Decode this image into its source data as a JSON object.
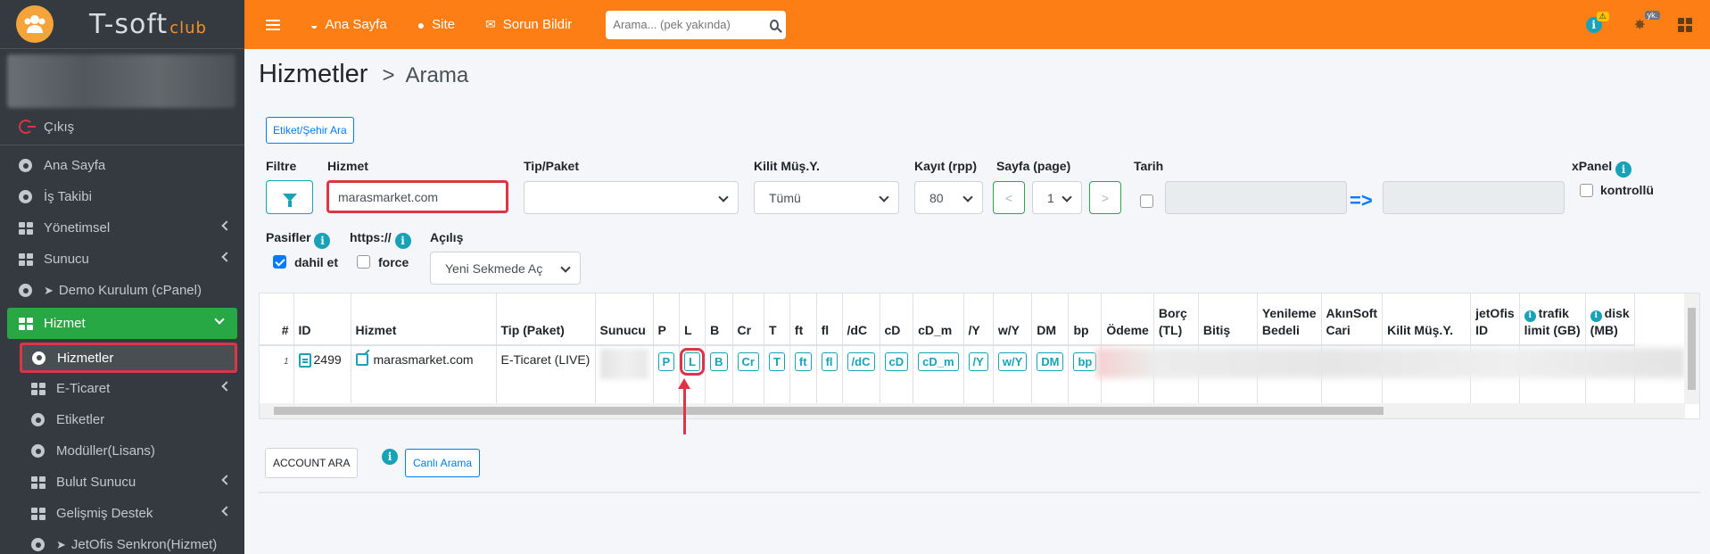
{
  "brand": {
    "name": "T-soft",
    "suffix": "club"
  },
  "sidebar": {
    "logout": "Çıkış",
    "items": [
      {
        "label": "Ana Sayfa",
        "icon": "circle-icon"
      },
      {
        "label": "İş Takibi",
        "icon": "circle-icon"
      },
      {
        "label": "Yönetimsel",
        "icon": "grid-icon",
        "has_children": true
      },
      {
        "label": "Sunucu",
        "icon": "grid-icon",
        "has_children": true
      },
      {
        "label": "Demo Kurulum (cPanel)",
        "icon": "circle-icon"
      },
      {
        "label": "Hizmet",
        "icon": "grid-icon",
        "active": true
      },
      {
        "label": "Hizmetler",
        "icon": "circle-icon",
        "active": true
      },
      {
        "label": "E-Ticaret",
        "icon": "grid-icon",
        "has_children": true
      },
      {
        "label": "Etiketler",
        "icon": "circle-icon"
      },
      {
        "label": "Modüller(Lisans)",
        "icon": "circle-icon"
      },
      {
        "label": "Bulut Sunucu",
        "icon": "grid-icon",
        "has_children": true
      },
      {
        "label": "Gelişmiş Destek",
        "icon": "grid-icon",
        "has_children": true
      },
      {
        "label": "JetOfis Senkron(Hizmet)",
        "icon": "circle-icon"
      }
    ]
  },
  "topbar": {
    "links": [
      "Ana Sayfa",
      "Site",
      "Sorun Bildir"
    ],
    "search_placeholder": "Arama... (pek yakında)",
    "badge_warn": "⚠",
    "badge_user": "yk."
  },
  "page": {
    "title": "Hizmetler",
    "breadcrumb": "Arama",
    "etiket_button": "Etiket/Şehir Ara"
  },
  "filters": {
    "filtre_label": "Filtre",
    "hizmet_label": "Hizmet",
    "hizmet_value": "marasmarket.com",
    "tip_label": "Tip/Paket",
    "tip_value": "",
    "kilit_label": "Kilit Müş.Y.",
    "kilit_value": "Tümü",
    "kayit_label": "Kayıt (rpp)",
    "kayit_value": "80",
    "sayfa_label": "Sayfa (page)",
    "sayfa_value": "1",
    "prev": "<",
    "next": ">",
    "tarih_label": "Tarih",
    "tarih_arrow": "=>",
    "xpanel_label": "xPanel",
    "xpanel_option": "kontrollü",
    "pasifler_label": "Pasifler",
    "pasifler_option": "dahil et",
    "https_label": "https://",
    "https_option": "force",
    "acilis_label": "Açılış",
    "acilis_value": "Yeni Sekmede Aç"
  },
  "table": {
    "headers": [
      "#",
      "ID",
      "Hizmet",
      "Tip (Paket)",
      "Sunucu",
      "P",
      "L",
      "B",
      "Cr",
      "T",
      "ft",
      "fl",
      "/dC",
      "cD",
      "cD_m",
      "/Y",
      "w/Y",
      "DM",
      "bp",
      "Ödeme",
      "Borç\n(TL)",
      "Bitiş",
      "Yenileme\nBedeli",
      "AkınSoft\nCari",
      "Kilit Müş.Y.",
      "jetOfis\nID",
      "trafik\nlimit (GB)",
      "disk\n(MB)"
    ],
    "row": {
      "num": "1",
      "id": "2499",
      "hizmet": "marasmarket.com",
      "tip": "E-Ticaret (LIVE)",
      "buttons": [
        "P",
        "L",
        "B",
        "Cr",
        "T",
        "ft",
        "fl",
        "/dC",
        "cD",
        "cD_m",
        "/Y",
        "w/Y",
        "DM",
        "bp"
      ]
    }
  },
  "bottom": {
    "account_button": "ACCOUNT ARA",
    "canli_button": "Canlı Arama"
  },
  "colors": {
    "accent": "#fd7e14",
    "sidebar": "#343a40",
    "active": "#28a745",
    "highlight": "#dc3545",
    "info": "#17a2b8"
  }
}
